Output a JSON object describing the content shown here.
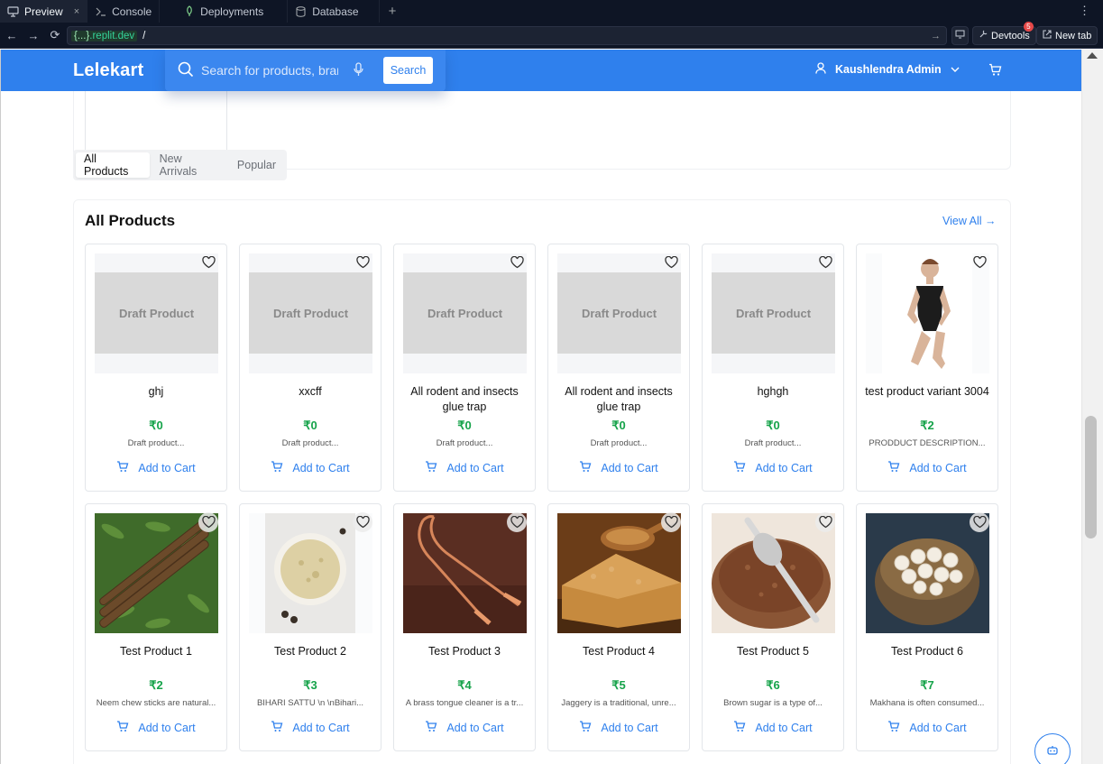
{
  "chrome": {
    "tabs": [
      {
        "label": "Preview",
        "icon": "monitor-icon",
        "active": true
      },
      {
        "label": "Console",
        "icon": "terminal-icon"
      },
      {
        "label": "Deployments",
        "icon": "deploy-icon"
      },
      {
        "label": "Database",
        "icon": "database-icon"
      }
    ],
    "tab_close": "×",
    "tab_add": "+",
    "url_host_prefix": "{...}",
    "url_host_suffix": ".replit.dev",
    "url_path": "/",
    "devtools_label": "Devtools",
    "devtools_badge": "5",
    "newtab_label": "New tab"
  },
  "header": {
    "logo": "Lelekart",
    "search_placeholder": "Search for products, brands and more",
    "search_button": "Search",
    "user_name": "Kaushlendra Admin"
  },
  "tabs": [
    "All Products",
    "New Arrivals",
    "Popular"
  ],
  "section": {
    "title": "All Products",
    "view_all": "View All →"
  },
  "add_to_cart_label": "Add to Cart",
  "draft_label": "Draft Product",
  "products": [
    {
      "name": "ghj",
      "price": "₹0",
      "desc": "Draft product...",
      "image": "draft"
    },
    {
      "name": "xxcff",
      "price": "₹0",
      "desc": "Draft product...",
      "image": "draft"
    },
    {
      "name": "All rodent and insects glue trap",
      "price": "₹0",
      "desc": "Draft product...",
      "image": "draft"
    },
    {
      "name": "All rodent and insects glue trap",
      "price": "₹0",
      "desc": "Draft product...",
      "image": "draft"
    },
    {
      "name": "hghgh",
      "price": "₹0",
      "desc": "Draft product...",
      "image": "draft"
    },
    {
      "name": "test product variant 3004",
      "price": "₹2",
      "desc": "PRODDUCT DESCRIPTION...",
      "image": "swimsuit-model"
    },
    {
      "name": "Test Product 1",
      "price": "₹2",
      "desc": "Neem chew sticks are natural...",
      "image": "neem-sticks"
    },
    {
      "name": "Test Product 2",
      "price": "₹3",
      "desc": "BIHARI SATTU \\n \\nBihari...",
      "image": "sattu-bowl"
    },
    {
      "name": "Test Product 3",
      "price": "₹4",
      "desc": "A brass tongue cleaner is a tr...",
      "image": "tongue-cleaner"
    },
    {
      "name": "Test Product 4",
      "price": "₹5",
      "desc": "Jaggery is a traditional, unre...",
      "image": "jaggery"
    },
    {
      "name": "Test Product 5",
      "price": "₹6",
      "desc": "Brown sugar is a type of...",
      "image": "brown-sugar"
    },
    {
      "name": "Test Product 6",
      "price": "₹7",
      "desc": "Makhana is often consumed...",
      "image": "makhana"
    }
  ],
  "colors": {
    "brand_blue": "#2f80ed",
    "price_green": "#16a34a",
    "chrome_dark": "#0e1525"
  }
}
